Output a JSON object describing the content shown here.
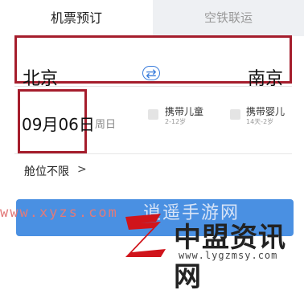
{
  "tabs": [
    {
      "label": "机票预订",
      "active": true
    },
    {
      "label": "空铁联运",
      "active": false
    }
  ],
  "route": {
    "from_city": "北京",
    "to_city": "南京",
    "swap_icon": "swap-arrows-icon"
  },
  "date": {
    "value": "09月06日",
    "weekday": "周日"
  },
  "passenger_options": [
    {
      "label": "携带儿童",
      "sub": "2-12岁"
    },
    {
      "label": "携带婴儿",
      "sub": "14天-2岁"
    }
  ],
  "cabin": {
    "label": "舱位不限",
    "chevron": ">"
  },
  "watermark": {
    "site_text": "www.xyzs.com",
    "site_name": "逍遥手游网"
  },
  "logo": {
    "title": "中盟资讯网",
    "url": "www.lygzmsy.com"
  },
  "colors": {
    "highlight_box": "#a51d2c",
    "accent_blue": "#3a7ddc",
    "button_blue": "#4a90e2",
    "logo_red": "#d0141b"
  }
}
